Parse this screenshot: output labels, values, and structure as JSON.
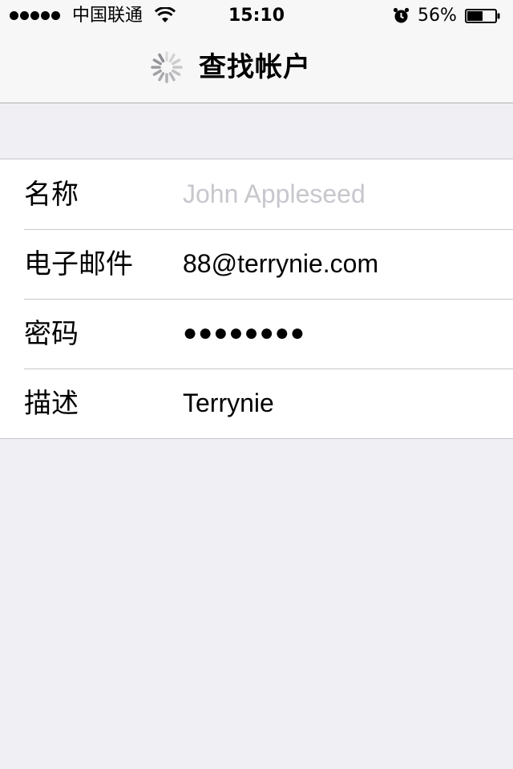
{
  "status_bar": {
    "carrier": "中国联通",
    "time": "15:10",
    "battery_percent": "56%",
    "battery_level": 0.56
  },
  "nav": {
    "title": "查找帐户",
    "loading_icon": "spinner-icon"
  },
  "form": {
    "rows": [
      {
        "label": "名称",
        "value": "",
        "placeholder": "John Appleseed"
      },
      {
        "label": "电子邮件",
        "value": "88@terrynie.com",
        "placeholder": ""
      },
      {
        "label": "密码",
        "value": "●●●●●●●●",
        "placeholder": ""
      },
      {
        "label": "描述",
        "value": "Terrynie",
        "placeholder": ""
      }
    ]
  },
  "colors": {
    "nav_background": "#f7f7f7",
    "page_background": "#efeff4",
    "placeholder_text": "#c7c7cd",
    "separator": "#c8c7cc"
  }
}
